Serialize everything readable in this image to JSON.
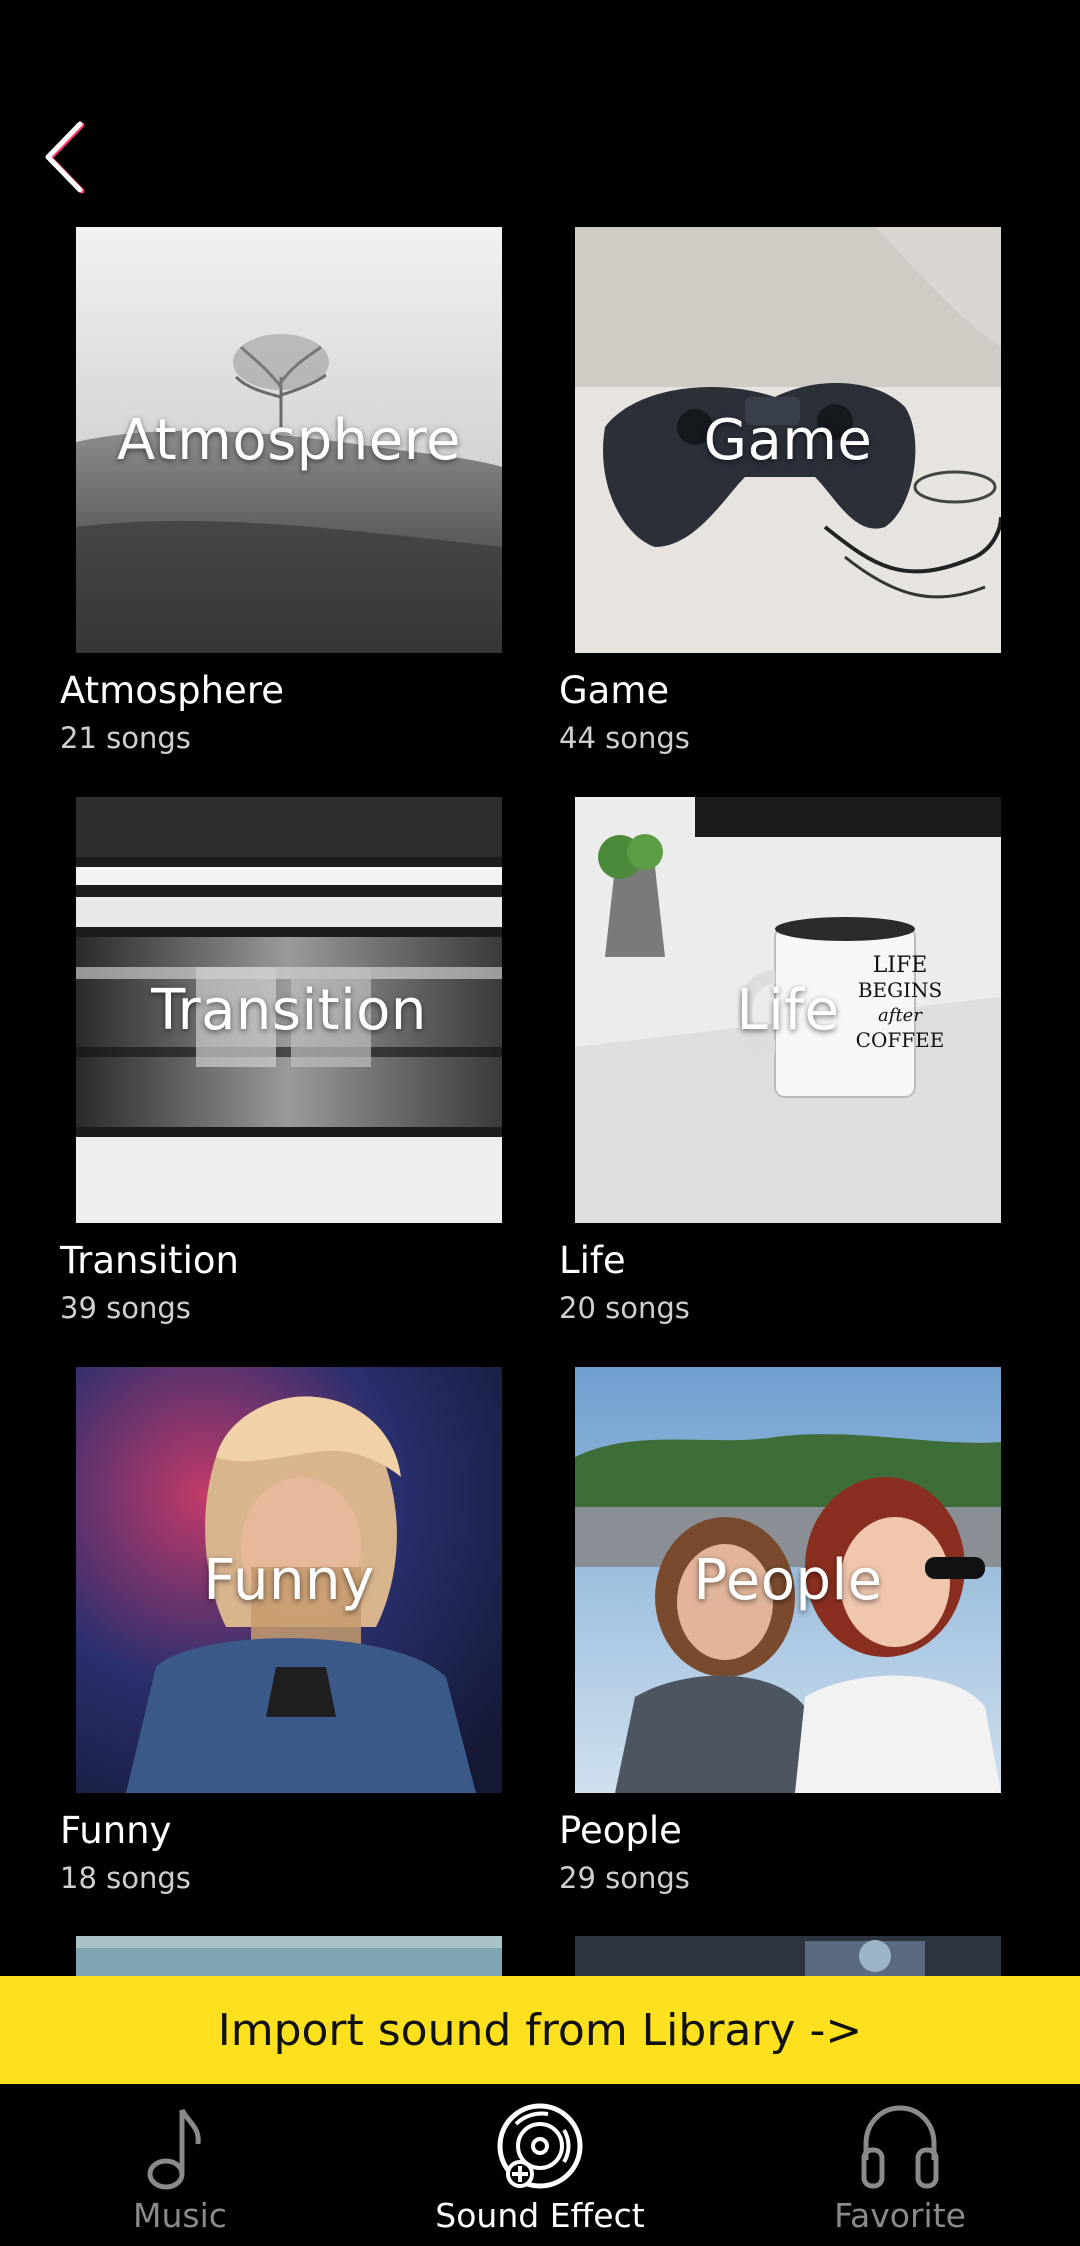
{
  "header": {
    "back_icon": "chevron-left-icon"
  },
  "categories": [
    {
      "title": "Atmosphere",
      "overlay": "Atmosphere",
      "count": "21 songs"
    },
    {
      "title": "Game",
      "overlay": "Game",
      "count": "44 songs"
    },
    {
      "title": "Transition",
      "overlay": "Transition",
      "count": "39 songs"
    },
    {
      "title": "Life",
      "overlay": "Life",
      "count": "20 songs"
    },
    {
      "title": "Funny",
      "overlay": "Funny",
      "count": "18 songs"
    },
    {
      "title": "People",
      "overlay": "People",
      "count": "29 songs"
    }
  ],
  "mug_text": [
    "LIFE",
    "BEGINS",
    "after",
    "COFFEE"
  ],
  "import_bar": {
    "label": "Import sound from Library ->"
  },
  "tabbar": {
    "tabs": [
      {
        "label": "Music",
        "icon": "music-note-icon",
        "active": false
      },
      {
        "label": "Sound Effect",
        "icon": "vinyl-disc-icon",
        "active": true
      },
      {
        "label": "Favorite",
        "icon": "headphones-icon",
        "active": false
      }
    ]
  },
  "colors": {
    "background": "#000000",
    "accent_yellow": "#fde11f",
    "inactive_tab": "#8a8a8a"
  }
}
